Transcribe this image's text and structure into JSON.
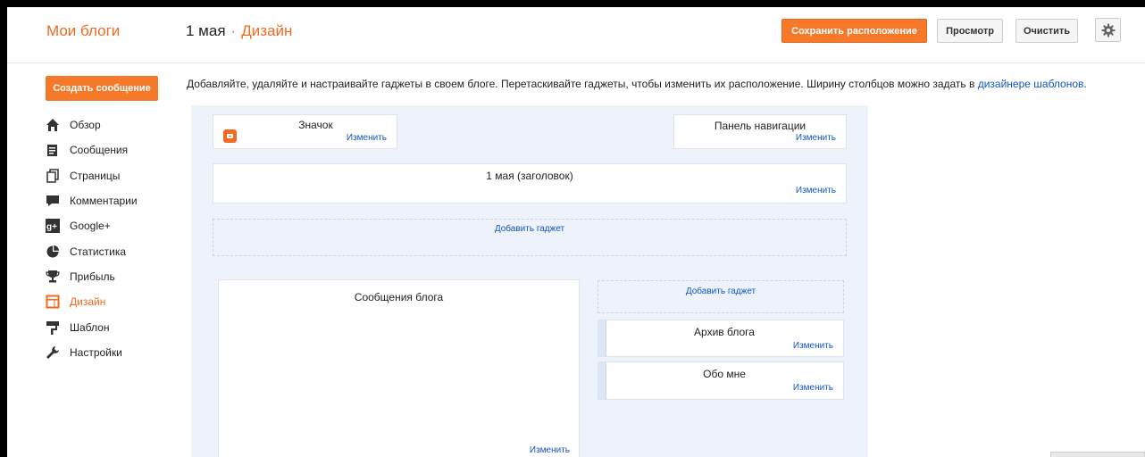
{
  "header": {
    "brand": "Мои блоги",
    "blog_name": "1 мая",
    "separator": "·",
    "section": "Дизайн",
    "save_label": "Сохранить расположение",
    "preview_label": "Просмотр",
    "clear_label": "Очистить"
  },
  "sidebar": {
    "create_label": "Создать сообщение",
    "items": [
      {
        "label": "Обзор",
        "icon": "home-icon"
      },
      {
        "label": "Сообщения",
        "icon": "posts-icon"
      },
      {
        "label": "Страницы",
        "icon": "pages-icon"
      },
      {
        "label": "Комментарии",
        "icon": "comments-icon"
      },
      {
        "label": "Google+",
        "icon": "google-plus-icon"
      },
      {
        "label": "Статистика",
        "icon": "stats-icon"
      },
      {
        "label": "Прибыль",
        "icon": "earnings-icon"
      },
      {
        "label": "Дизайн",
        "icon": "layout-icon"
      },
      {
        "label": "Шаблон",
        "icon": "template-icon"
      },
      {
        "label": "Настройки",
        "icon": "settings-icon"
      }
    ],
    "active_item": "Дизайн"
  },
  "intro": {
    "text": "Добавляйте, удаляйте и настраивайте гаджеты в своем блоге. Перетаскивайте гаджеты, чтобы изменить их расположение. Ширину столбцов можно задать в ",
    "link": "дизайнере шаблонов",
    "end": "."
  },
  "layout": {
    "favicon_title": "Значок",
    "navbar_title": "Панель навигации",
    "header_title": "1 мая (заголовок)",
    "posts_title": "Сообщения блога",
    "archive_title": "Архив блога",
    "about_title": "Обо мне",
    "edit_label": "Изменить",
    "add_gadget_label": "Добавить гаджет"
  },
  "colors": {
    "accent": "#f26a21",
    "link": "#1155cc",
    "canvas_bg": "#eef3fb"
  }
}
